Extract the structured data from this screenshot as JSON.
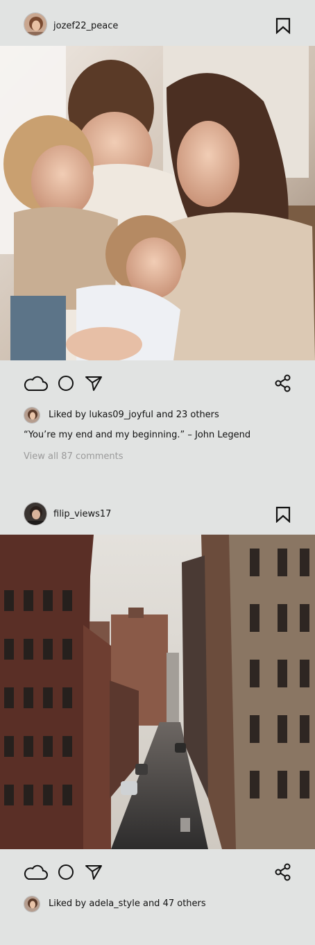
{
  "posts": [
    {
      "username": "jozef22_peace",
      "likes_text": "Liked by lukas09_joyful and 23 others",
      "caption": "“You’re my end and my beginning.” – John Legend",
      "comments_link": "View all 87 comments",
      "photo_alt": "Family cuddling on a couch"
    },
    {
      "username": "filip_views17",
      "likes_text": "Liked by adela_style and 47 others",
      "photo_alt": "City street between brick buildings"
    }
  ],
  "icons": {
    "bookmark": "bookmark-icon",
    "like": "cloud-like-icon",
    "comment": "circle-comment-icon",
    "send": "send-icon",
    "share": "share-icon"
  },
  "colors": {
    "background": "#e1e3e2",
    "text": "#111111",
    "muted": "#9a9a9a"
  }
}
